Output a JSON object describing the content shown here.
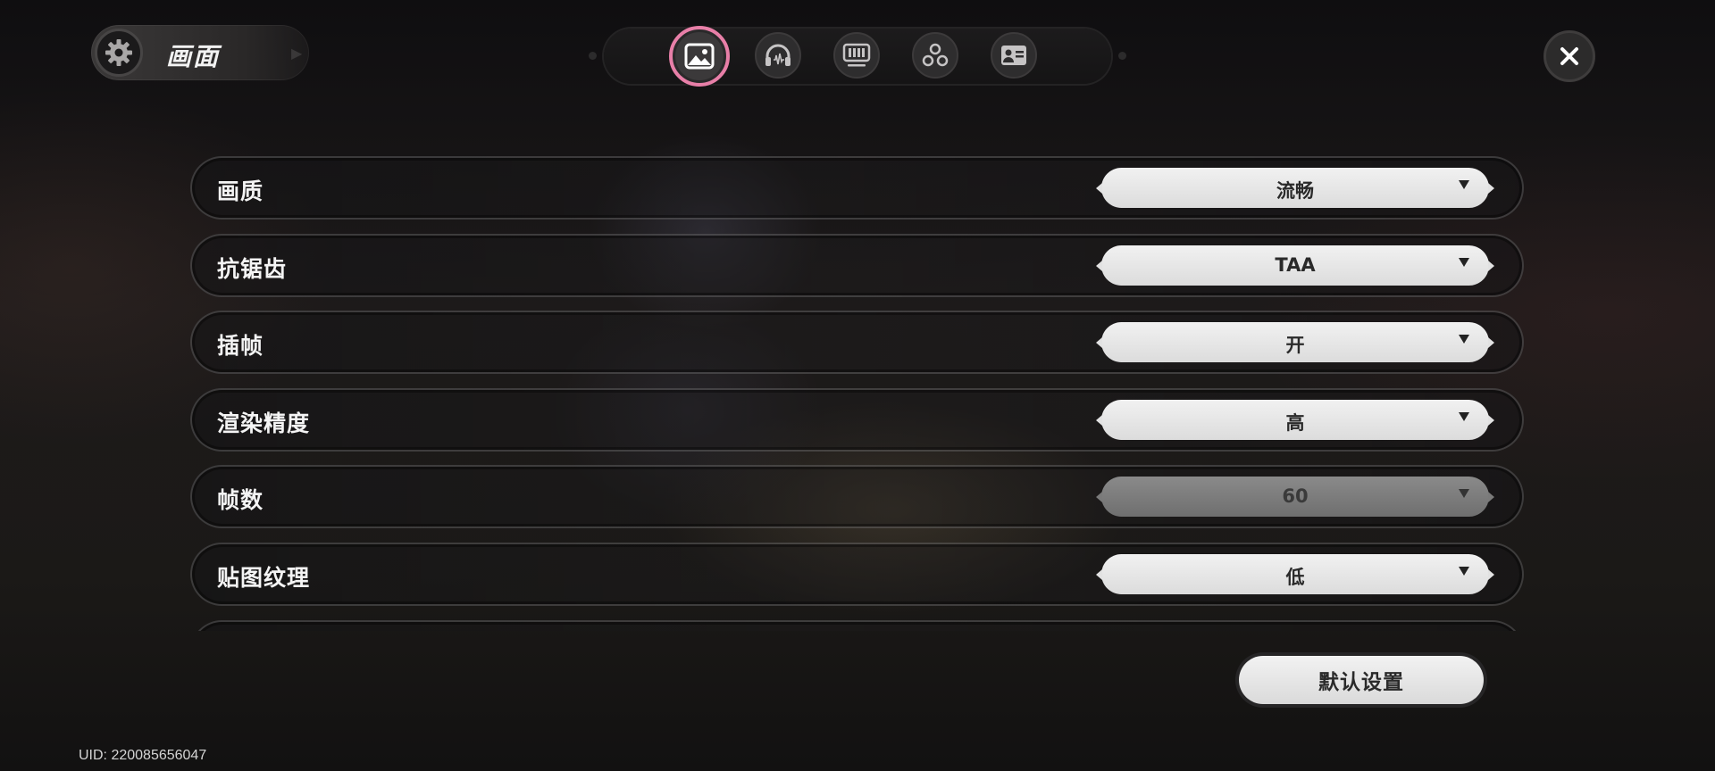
{
  "header": {
    "title": "画面",
    "icon": "gear-icon"
  },
  "tabs": [
    {
      "name": "graphics",
      "icon": "picture-icon",
      "active": true
    },
    {
      "name": "audio",
      "icon": "headphones-icon",
      "active": false
    },
    {
      "name": "controls",
      "icon": "keyboard-icon",
      "active": false
    },
    {
      "name": "social",
      "icon": "circles-icon",
      "active": false
    },
    {
      "name": "account",
      "icon": "id-card-icon",
      "active": false
    }
  ],
  "settings": [
    {
      "label": "画质",
      "value": "流畅",
      "disabled": false
    },
    {
      "label": "抗锯齿",
      "value": "TAA",
      "disabled": false
    },
    {
      "label": "插帧",
      "value": "开",
      "disabled": false
    },
    {
      "label": "渲染精度",
      "value": "高",
      "disabled": false
    },
    {
      "label": "帧数",
      "value": "60",
      "disabled": true
    },
    {
      "label": "贴图纹理",
      "value": "低",
      "disabled": false
    }
  ],
  "default_button": {
    "label": "默认设置"
  },
  "uid": "UID: 220085656047",
  "colors": {
    "accent": "#e87fa8",
    "select_bg": "#e6e6e6",
    "select_disabled_bg": "#7c7c7c"
  }
}
